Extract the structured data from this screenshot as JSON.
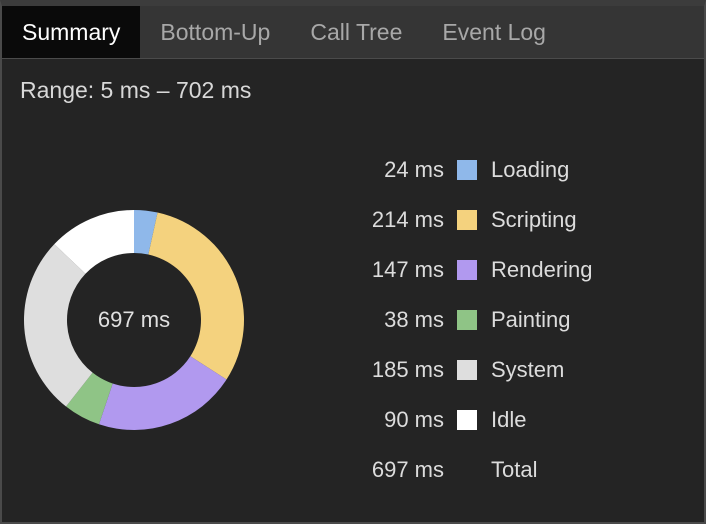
{
  "tabs": [
    {
      "label": "Summary",
      "active": true
    },
    {
      "label": "Bottom-Up",
      "active": false
    },
    {
      "label": "Call Tree",
      "active": false
    },
    {
      "label": "Event Log",
      "active": false
    }
  ],
  "range_text": "Range: 5 ms – 702 ms",
  "donut_center": "697 ms",
  "legend": [
    {
      "value": "24 ms",
      "label": "Loading",
      "color": "#8fb8ea"
    },
    {
      "value": "214 ms",
      "label": "Scripting",
      "color": "#f4d27e"
    },
    {
      "value": "147 ms",
      "label": "Rendering",
      "color": "#b199ef"
    },
    {
      "value": "38 ms",
      "label": "Painting",
      "color": "#8fc486"
    },
    {
      "value": "185 ms",
      "label": "System",
      "color": "#dedede"
    },
    {
      "value": "90 ms",
      "label": "Idle",
      "color": "#ffffff"
    }
  ],
  "total": {
    "value": "697 ms",
    "label": "Total"
  },
  "chart_data": {
    "type": "pie",
    "categories": [
      "Loading",
      "Scripting",
      "Rendering",
      "Painting",
      "System",
      "Idle"
    ],
    "values": [
      24,
      214,
      147,
      38,
      185,
      90
    ],
    "total": 697
  }
}
